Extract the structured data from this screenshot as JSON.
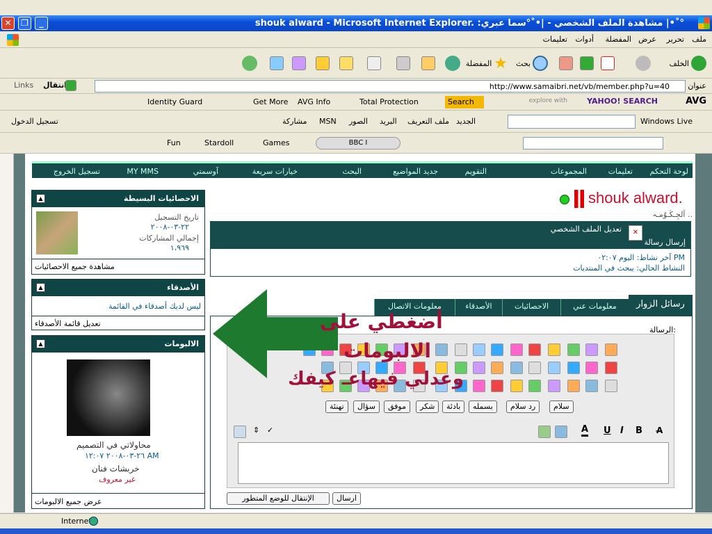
{
  "window": {
    "title": "shouk alward - Microsoft Internet Explorer. :مشاهدة الملف الشخصي - |•˚°سما عبري |•˚°"
  },
  "menu": [
    "ملف",
    "تحرير",
    "عرض",
    "المفضلة",
    "أدوات",
    "تعليمات"
  ],
  "toolbar": {
    "back": "الخلف",
    "search": "بحث",
    "favorites": "المفضلة"
  },
  "address": {
    "label": "عنوان",
    "url": "http://www.samaibri.net/vb/member.php?u=40",
    "go": "انتقال",
    "links": "Links"
  },
  "avgbar": {
    "avg": "AVG",
    "yahoo": "YAHOO! SEARCH",
    "explore": "explore with",
    "search": "Search",
    "total": "Total Protection",
    "avginfo": "AVG Info",
    "getmore": "Get More",
    "identity": "Identity Guard"
  },
  "livebar": {
    "windows_live": "Windows Live",
    "items": [
      "الجديد",
      "ملف التعريف",
      "البريد",
      "الصور",
      "MSN",
      "مشاركة"
    ],
    "signin": "تسجيل الدخول"
  },
  "favbar": {
    "games": "Games",
    "stardoll": "Stardoll",
    "fun": "Fun",
    "bbc": "BBC I"
  },
  "nav": [
    "لوحة التحكم",
    "تعليمات",
    "المجموعات",
    "التقويم",
    "جديد المواضيع",
    "البحث",
    "خيارات سريعة",
    "آوسمتي",
    "MY MMS",
    "تسجيل الخروج"
  ],
  "profile": {
    "name": "shouk alward.",
    "subtitle": "اَلجِـكَـوُمـہ ..",
    "edit": "تعديل الملف الشخصي",
    "send": "إرسال رسالة",
    "last_activity": "آخر نشاط: اليوم ٠٢:٠٧ PM",
    "current_activity": "النشاط الحالي: يبحث في المنتديات"
  },
  "tabs": [
    "رسائل الزوار",
    "معلومات عني",
    "الاحصائيات",
    "الأصدقاء",
    "معلومات الاتصال"
  ],
  "editor": {
    "message_label": "الرسالة:",
    "quick": [
      "سلام",
      "رد سلام",
      "بسمله",
      "بادئة",
      "شكر",
      "موفق",
      "سؤال",
      "تهنئة"
    ],
    "send": "ارسال",
    "advanced": "الإنتقال للوضع المتطور"
  },
  "overlay": {
    "line1": "أضغطي على",
    "line2": "الالبومات",
    "line3": "وعدلي فيهاعـ كيفك"
  },
  "stats": {
    "title": "الاحصائيات البسيطة",
    "reg_label": "تاريخ التسجيل",
    "reg_date": "٢٢-٠٣-٢٠٠٨",
    "posts_label": "إجمالي المشاركات",
    "posts": "١،٩٦٩",
    "view_all": "مشاهدة جميع الاحصائيات"
  },
  "friends": {
    "title": "الأصدقاء",
    "empty": "ليس لديك أصدقاء في القائمة",
    "edit": "تعديل قائمة الأصدقاء"
  },
  "albums": {
    "title": "الالبومات",
    "album_name": "محاولاتي في التصميم",
    "album_date": "٢٦-٠٣-٢٠٠٨ ١٢:٠٧ AM",
    "owner": "خربشات فنان",
    "status": "غير معروف",
    "view_all": "عرض جميع الالبومات"
  },
  "statusbar": {
    "zone": "Internet"
  },
  "colors": {
    "accent": "#164c4c",
    "arrow": "#1e7a2e",
    "overlay_text": "#a0123a"
  }
}
